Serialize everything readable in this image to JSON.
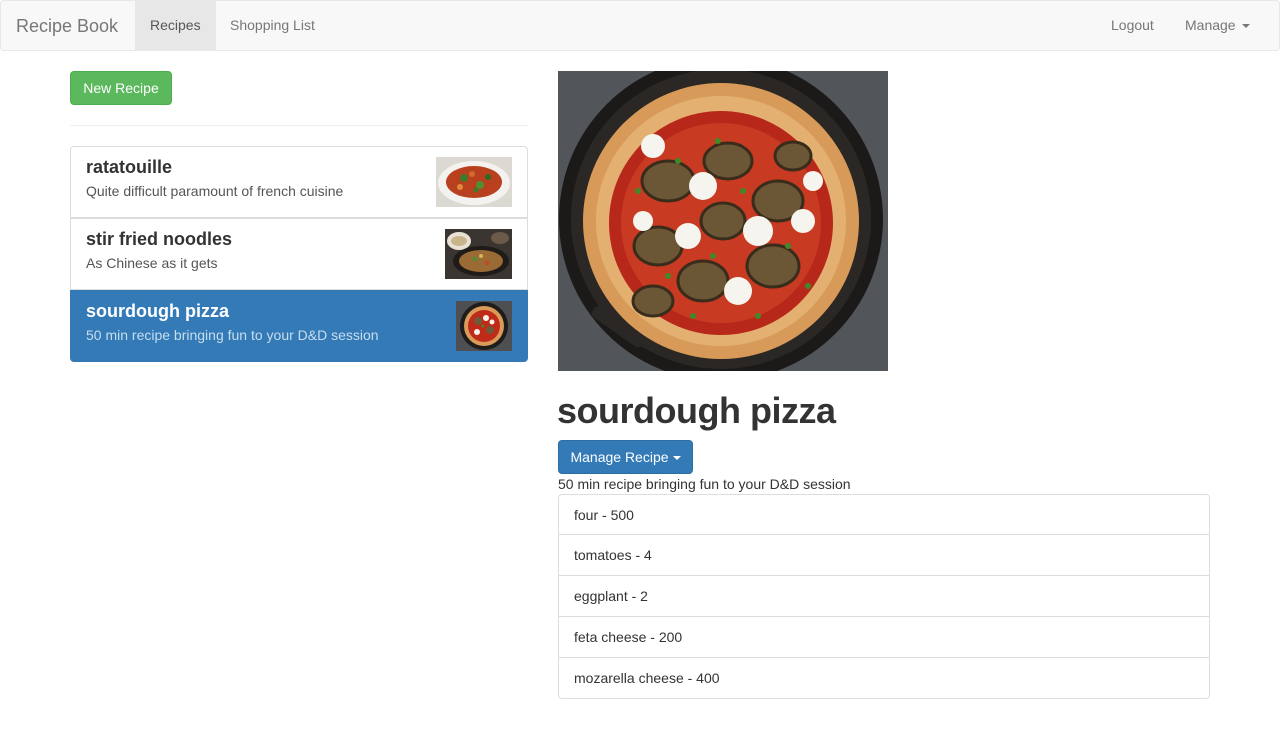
{
  "navbar": {
    "brand": "Recipe Book",
    "links": [
      {
        "label": "Recipes",
        "active": true
      },
      {
        "label": "Shopping List",
        "active": false
      }
    ],
    "logout": "Logout",
    "manage": "Manage"
  },
  "sidebar": {
    "new_recipe_label": "New Recipe",
    "recipes": [
      {
        "name": "ratatouille",
        "description": "Quite difficult paramount of french cuisine",
        "image": "ratatouille-photo"
      },
      {
        "name": "stir fried noodles",
        "description": "As Chinese as it gets",
        "image": "noodles-photo"
      },
      {
        "name": "sourdough pizza",
        "description": "50 min recipe bringing fun to your D&D session",
        "image": "pizza-photo",
        "selected": true
      }
    ]
  },
  "detail": {
    "title": "sourdough pizza",
    "manage_label": "Manage Recipe",
    "description": "50 min recipe bringing fun to your D&D session",
    "ingredients": [
      {
        "text": "four - 500"
      },
      {
        "text": "tomatoes - 4"
      },
      {
        "text": "eggplant - 2"
      },
      {
        "text": "feta cheese - 200"
      },
      {
        "text": "mozarella cheese - 400"
      }
    ]
  },
  "colors": {
    "primary": "#337ab7",
    "success": "#5cb85c",
    "navbar_bg": "#f8f8f8"
  }
}
